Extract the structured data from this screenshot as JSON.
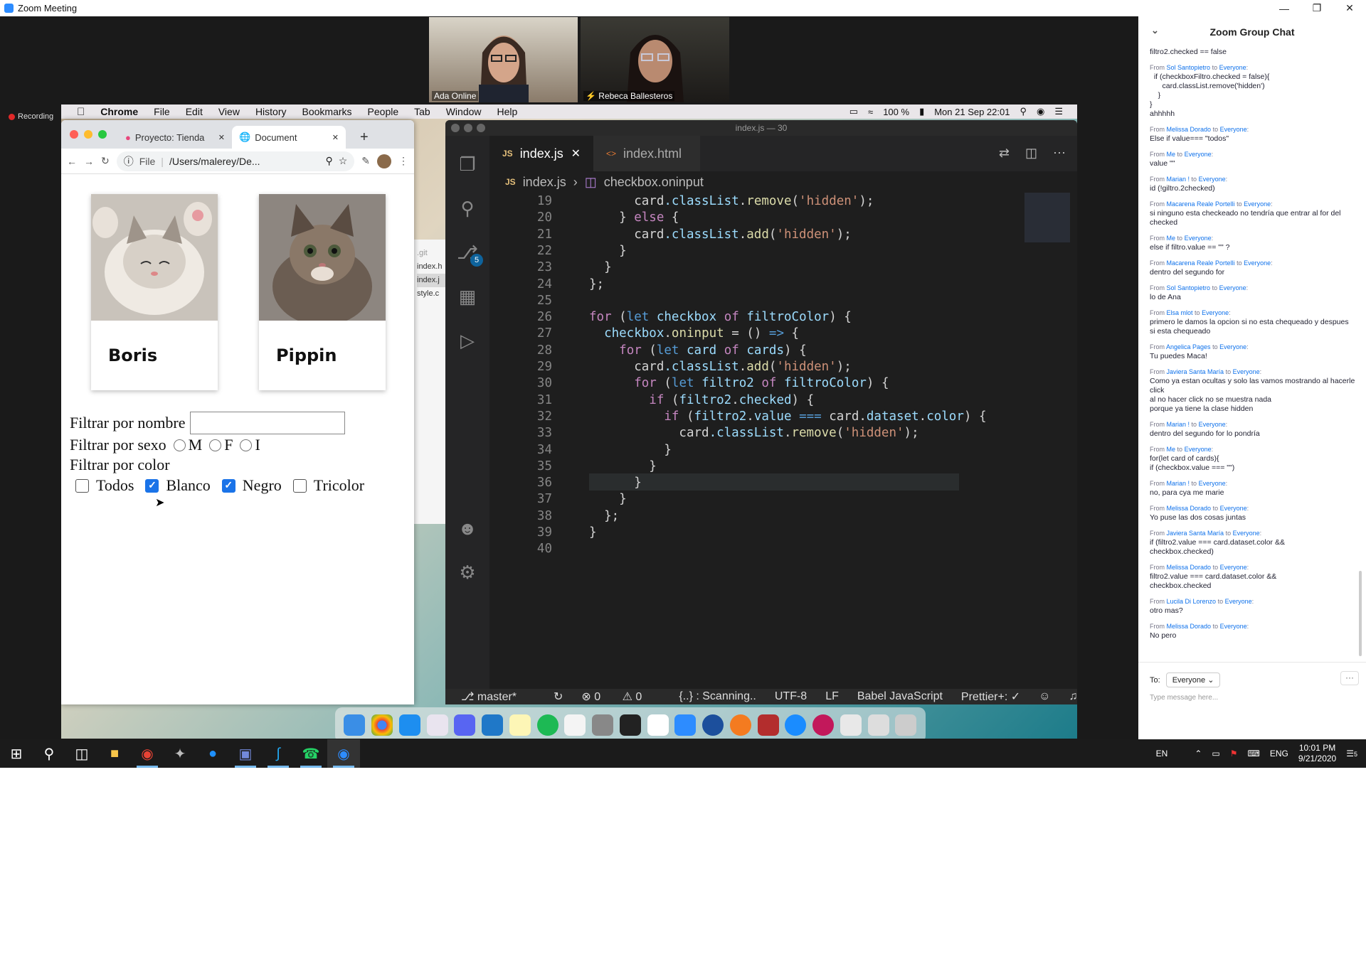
{
  "zoom": {
    "window_title": "Zoom Meeting",
    "recording_label": "Recording",
    "participants": [
      {
        "name": "Ada Online"
      },
      {
        "name": "Rebeca Ballesteros"
      }
    ]
  },
  "mac_menu": {
    "app": "Chrome",
    "items": [
      "File",
      "Edit",
      "View",
      "History",
      "Bookmarks",
      "People",
      "Tab",
      "Window",
      "Help"
    ],
    "battery": "100 %",
    "datetime": "Mon 21 Sep  22:01"
  },
  "chrome": {
    "tabs": [
      {
        "label": "Proyecto: Tienda"
      },
      {
        "label": "Document"
      }
    ],
    "new_tab": "+",
    "url_prefix": "File",
    "url": "/Users/malerey/De..."
  },
  "page": {
    "cards": [
      {
        "name": "Boris"
      },
      {
        "name": "Pippin"
      }
    ],
    "filter_name_label": "Filtrar por nombre",
    "filter_name_value": "",
    "filter_sex_label": "Filtrar por sexo",
    "sex_options": [
      "M",
      "F",
      "I"
    ],
    "filter_color_label": "Filtrar por color",
    "color_options": [
      {
        "label": "Todos",
        "checked": false
      },
      {
        "label": "Blanco",
        "checked": true
      },
      {
        "label": "Negro",
        "checked": true
      },
      {
        "label": "Tricolor",
        "checked": false
      }
    ],
    "explorer_peek": [
      ".git",
      "index.h",
      "index.j",
      "style.c"
    ]
  },
  "vscode": {
    "title": "index.js — 30",
    "tabs": [
      {
        "icon": "JS",
        "label": "index.js",
        "close": "✕"
      },
      {
        "icon": "<>",
        "label": "index.html"
      }
    ],
    "breadcrumb": {
      "file_icon": "JS",
      "file": "index.js",
      "symbol": "checkbox.oninput"
    },
    "source_control_badge": "5",
    "code_lines": [
      {
        "n": "19",
        "html": "      card<span class='pr'>.</span><span class='pr'>classList</span>.<span class='fn'>remove</span>(<span class='str'>'hidden'</span>);"
      },
      {
        "n": "20",
        "html": "    } <span class='kw'>else</span> {"
      },
      {
        "n": "21",
        "html": "      card<span class='pr'>.classList</span>.<span class='fn'>add</span>(<span class='str'>'hidden'</span>);"
      },
      {
        "n": "22",
        "html": "    }"
      },
      {
        "n": "23",
        "html": "  }"
      },
      {
        "n": "24",
        "html": "};"
      },
      {
        "n": "25",
        "html": ""
      },
      {
        "n": "26",
        "html": "<span class='kw'>for</span> (<span class='ty'>let</span> <span class='pr'>checkbox</span> <span class='kw'>of</span> <span class='pr'>filtroColor</span>) {"
      },
      {
        "n": "27",
        "html": "  <span class='pr'>checkbox</span>.<span class='fn'>oninput</span> = () <span class='ty'>=&gt;</span> {"
      },
      {
        "n": "28",
        "html": "    <span class='kw'>for</span> (<span class='ty'>let</span> <span class='pr'>card</span> <span class='kw'>of</span> <span class='pr'>cards</span>) {"
      },
      {
        "n": "29",
        "html": "      card<span class='pr'>.classList</span>.<span class='fn'>add</span>(<span class='str'>'hidden'</span>);"
      },
      {
        "n": "30",
        "html": "      <span class='kw'>for</span> (<span class='ty'>let</span> <span class='pr'>filtro2</span> <span class='kw'>of</span> <span class='pr'>filtroColor</span>) {"
      },
      {
        "n": "31",
        "html": "        <span class='kw'>if</span> (<span class='pr'>filtro2</span>.<span class='pr'>checked</span>) {"
      },
      {
        "n": "32",
        "html": "          <span class='kw'>if</span> (<span class='pr'>filtro2</span>.<span class='pr'>value</span> <span class='ty'>===</span> card.<span class='pr'>dataset</span>.<span class='pr'>color</span>) {"
      },
      {
        "n": "33",
        "html": "            card<span class='pr'>.classList</span>.<span class='fn'>remove</span>(<span class='str'>'hidden'</span>);"
      },
      {
        "n": "34",
        "html": "          }"
      },
      {
        "n": "35",
        "html": "        }"
      },
      {
        "n": "36",
        "html": "      }"
      },
      {
        "n": "37",
        "html": "    }"
      },
      {
        "n": "38",
        "html": "  };"
      },
      {
        "n": "39",
        "html": "}"
      },
      {
        "n": "40",
        "html": ""
      }
    ],
    "status": {
      "branch": "master*",
      "errors": "0",
      "warnings": "0",
      "scanning": "{..} : Scanning..",
      "encoding": "UTF-8",
      "eol": "LF",
      "language": "Babel JavaScript",
      "prettier": "Prettier+: ✓"
    }
  },
  "chat": {
    "title": "Zoom Group Chat",
    "top_fragment": "filtro2.checked == false",
    "messages": [
      {
        "from": "Sol Santopietro",
        "to": "Everyone",
        "text": "  if (checkboxFiltro.checked = false){\n      card.classList.remove('hidden')\n    }\n}\nahhhhh"
      },
      {
        "from": "Melissa Dorado",
        "to": "Everyone",
        "text": "Else if value=== \"todos\""
      },
      {
        "from": "Me",
        "to": "Everyone",
        "text": "value \"\""
      },
      {
        "from": "Marian !",
        "to": "Everyone",
        "text": "id (!giltro.2checked)"
      },
      {
        "from": "Macarena Reale Portelli",
        "to": "Everyone",
        "text": "si ninguno esta checkeado no tendría que entrar al for del checked"
      },
      {
        "from": "Me",
        "to": "Everyone",
        "text": "else if filtro.value == \"\" ?"
      },
      {
        "from": "Macarena Reale Portelli",
        "to": "Everyone",
        "text": "dentro del segundo for"
      },
      {
        "from": "Sol Santopietro",
        "to": "Everyone",
        "text": "lo de Ana"
      },
      {
        "from": "Elsa mlot",
        "to": "Everyone",
        "text": "primero le damos la opcion si no esta chequeado y despues si esta chequeado"
      },
      {
        "from": "Angelica Pages",
        "to": "Everyone",
        "text": "Tu puedes Maca!"
      },
      {
        "from": "Javiera Santa María",
        "to": "Everyone",
        "text": "Como ya estan ocultas y solo las vamos mostrando al hacerle click\nal no hacer click no se muestra nada\nporque ya tiene la clase hidden"
      },
      {
        "from": "Marian !",
        "to": "Everyone",
        "text": "dentro del segundo for lo pondría"
      },
      {
        "from": "Me",
        "to": "Everyone",
        "text": "for(let card of cards){\nif (checkbox.value === \"\")"
      },
      {
        "from": "Marian !",
        "to": "Everyone",
        "text": "no, para cya me marie"
      },
      {
        "from": "Melissa Dorado",
        "to": "Everyone",
        "text": "Yo puse las dos cosas juntas"
      },
      {
        "from": "Javiera Santa María",
        "to": "Everyone",
        "text": "if (filtro2.value === card.dataset.color &&\ncheckbox.checked)"
      },
      {
        "from": "Melissa Dorado",
        "to": "Everyone",
        "text": "filtro2.value === card.dataset.color &&\ncheckbox.checked"
      },
      {
        "from": "Lucila Di Lorenzo",
        "to": "Everyone",
        "text": "otro mas?"
      },
      {
        "from": "Melissa Dorado",
        "to": "Everyone",
        "text": "No pero"
      }
    ],
    "from_prefix": "From",
    "to_word": "to",
    "to_label": "To:",
    "to_value": "Everyone",
    "more": "···",
    "placeholder": "Type message here..."
  },
  "taskbar": {
    "lang": "EN",
    "ime": "ENG",
    "time": "10:01 PM",
    "date": "9/21/2020",
    "notif_count": "5"
  }
}
